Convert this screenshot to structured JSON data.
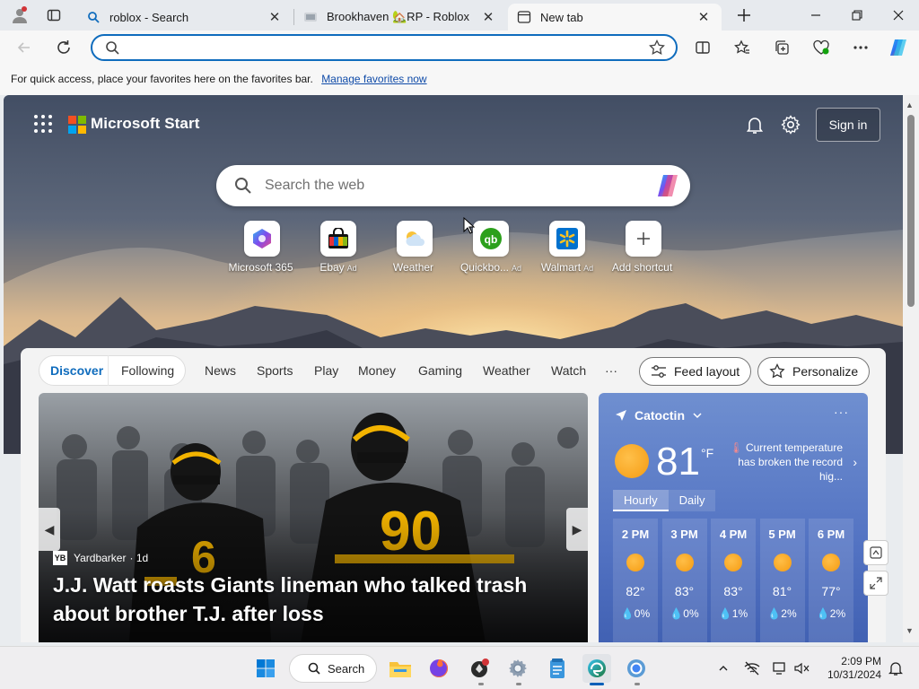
{
  "browser": {
    "tabs": [
      {
        "title": "roblox - Search",
        "icon": "bing-search-icon",
        "active": false
      },
      {
        "title": "Brookhaven 🏡RP - Roblox",
        "icon": "roblox-page-icon",
        "active": false
      },
      {
        "title": "New tab",
        "icon": "new-tab-icon",
        "active": true
      }
    ],
    "address_value": "",
    "favorites_bar": {
      "message": "For quick access, place your favorites here on the favorites bar.",
      "link": "Manage favorites now"
    }
  },
  "ms_start": {
    "brand": "Microsoft Start",
    "sign_in": "Sign in",
    "search_placeholder": "Search the web",
    "shortcuts": [
      {
        "label": "Microsoft 365",
        "ad": ""
      },
      {
        "label": "Ebay",
        "ad": "Ad"
      },
      {
        "label": "Weather",
        "ad": ""
      },
      {
        "label": "Quickbo...",
        "ad": "Ad"
      },
      {
        "label": "Walmart",
        "ad": "Ad"
      },
      {
        "label": "Add shortcut",
        "ad": ""
      }
    ]
  },
  "feed": {
    "pill": {
      "discover": "Discover",
      "following": "Following"
    },
    "nav": [
      "News",
      "Sports",
      "Play",
      "Money",
      "Gaming",
      "Weather",
      "Watch",
      "···"
    ],
    "feed_layout": "Feed layout",
    "personalize": "Personalize",
    "hero": {
      "source": "Yardbarker",
      "source_logo": "YB",
      "age": "· 1d",
      "headline": "J.J. Watt roasts Giants lineman who talked trash about brother T.J. after loss"
    }
  },
  "weather": {
    "location": "Catoctin",
    "more": "···",
    "temp": "81",
    "unit": "°F",
    "note": "Current temperature has broken the record hig...",
    "tabs": [
      "Hourly",
      "Daily"
    ],
    "hours": [
      {
        "time": "2 PM",
        "temp": "82°",
        "precip": "💧0%"
      },
      {
        "time": "3 PM",
        "temp": "83°",
        "precip": "💧0%"
      },
      {
        "time": "4 PM",
        "temp": "83°",
        "precip": "💧1%"
      },
      {
        "time": "5 PM",
        "temp": "81°",
        "precip": "💧2%"
      },
      {
        "time": "6 PM",
        "temp": "77°",
        "precip": "💧2%"
      }
    ]
  },
  "taskbar": {
    "search_label": "Search",
    "time": "2:09 PM",
    "date": "10/31/2024"
  },
  "colors": {
    "accent": "#0f6cbd",
    "weather_card": "#5272c2",
    "sun": "#f59b12"
  }
}
